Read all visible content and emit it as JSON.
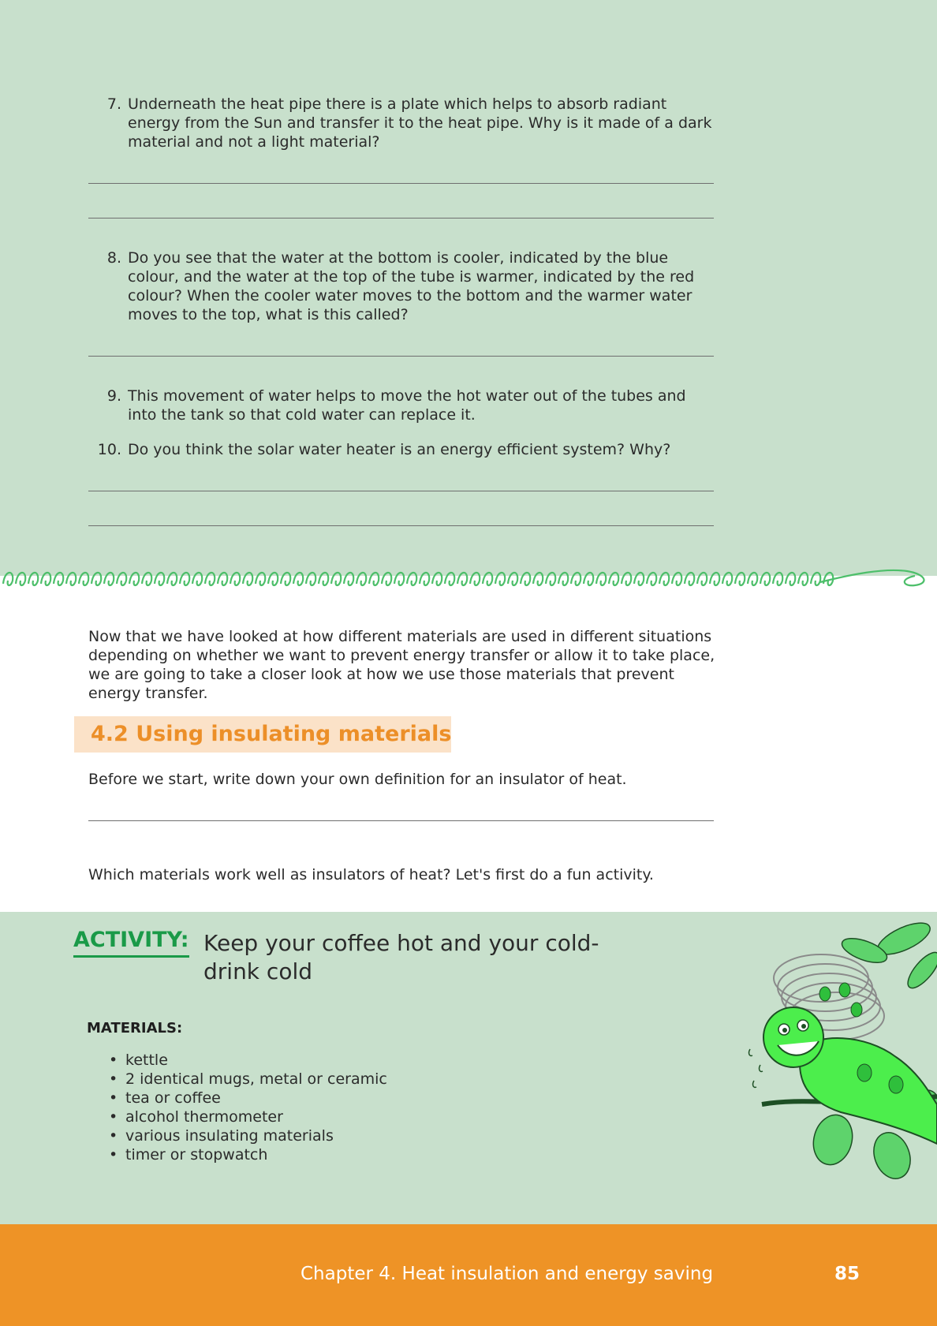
{
  "questions": [
    {
      "num": "7.",
      "text": "Underneath the heat pipe there is a plate which helps to absorb radiant energy from the Sun and transfer it to the heat pipe. Why is it made of a dark material and not a light material?"
    },
    {
      "num": "8.",
      "text": "Do you see that the water at the bottom is cooler, indicated by the blue colour, and the water at the top of the tube is warmer, indicated by the red colour? When the cooler water moves to the bottom and the warmer water moves to the top, what is this called?"
    },
    {
      "num": "9.",
      "text": "This movement of water helps to move the hot water out of the tubes and into the tank so that cold water can replace it."
    },
    {
      "num": "10.",
      "text": "Do you think the solar water heater is an energy efficient system? Why?"
    }
  ],
  "intro_paragraph": "Now that we have looked at how different materials are used in different situations depending on whether we want to prevent energy transfer or allow it to take place, we are going to take a closer look at how we use those materials that prevent energy transfer.",
  "section": {
    "title": "4.2  Using insulating materials"
  },
  "definition_prompt": "Before we start, write down your own definition for an insulator of heat.",
  "question_prompt": "Which materials work well as insulators of heat? Let's first do a fun activity.",
  "activity": {
    "label": "ACTIVITY:",
    "title": "Keep your coffee hot and your cold-drink cold",
    "materials_heading": "MATERIALS:",
    "materials": [
      "kettle",
      "2 identical mugs, metal or ceramic",
      "tea or coffee",
      "alcohol thermometer",
      "various insulating materials",
      "timer or stopwatch"
    ]
  },
  "footer": {
    "chapter": "Chapter 4.   Heat insulation and energy saving",
    "page_number": "85"
  },
  "colors": {
    "panel_green": "#c8e0cc",
    "accent_orange": "#ee9326",
    "section_box": "#fbe2c8",
    "activity_green": "#1a9a48"
  }
}
